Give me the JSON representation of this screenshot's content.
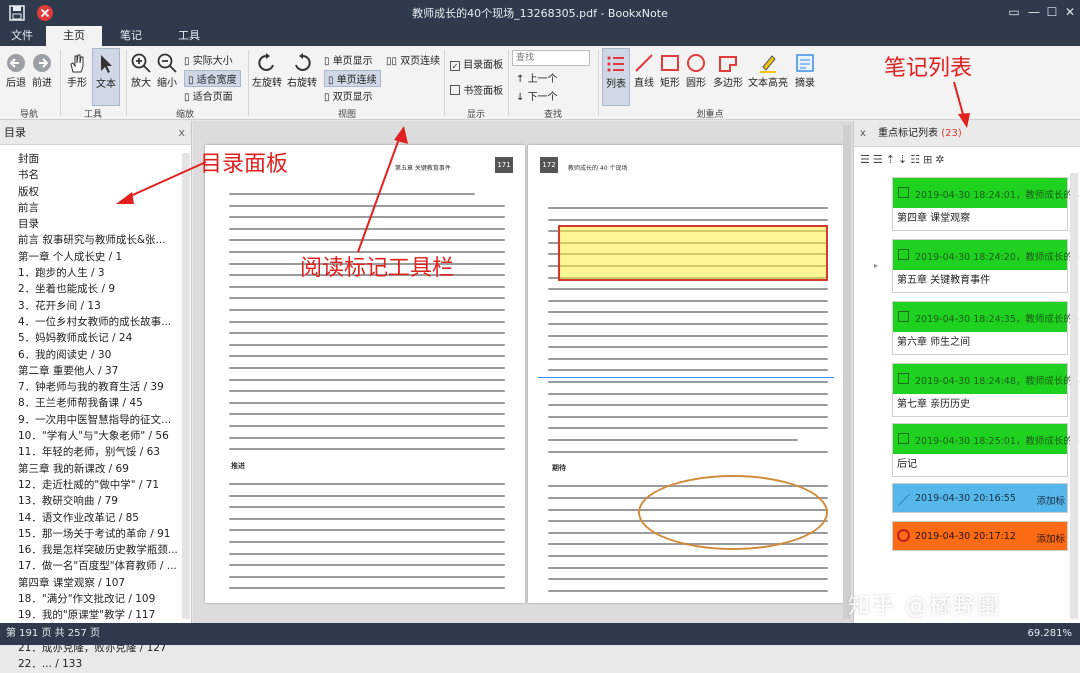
{
  "window": {
    "title": "教师成长的40个现场_13268305.pdf - BookxNote"
  },
  "tabs": [
    "文件",
    "主页",
    "笔记",
    "工具"
  ],
  "ribbon": {
    "nav": {
      "back": "后退",
      "forward": "前进",
      "group": "导航"
    },
    "tools": {
      "hand": "手形",
      "text": "文本",
      "group": "工具"
    },
    "zoom": {
      "zoom_in": "放大",
      "zoom_out": "缩小",
      "actual": "实际大小",
      "fit_width": "适合宽度",
      "fit_page": "适合页面",
      "group": "缩放"
    },
    "view": {
      "rotate_left": "左旋转",
      "rotate_right": "右旋转",
      "single": "单页显示",
      "single_cont": "单页连续",
      "double": "双页显示",
      "double_cont": "双页连续",
      "group": "视图"
    },
    "display": {
      "toc_panel": "目录面板",
      "bookmark_panel": "书签面板",
      "group": "显示"
    },
    "search": {
      "placeholder": "查找",
      "prev": "上一个",
      "next": "下一个",
      "group": "查找"
    },
    "mark": {
      "list": "列表",
      "line": "直线",
      "rect": "矩形",
      "circle": "圆形",
      "polygon": "多边形",
      "highlight": "文本高亮",
      "excerpt": "摘录",
      "group": "划重点"
    }
  },
  "left_panel": {
    "title": "目录",
    "close": "x",
    "items": [
      "封面",
      "书名",
      "版权",
      "前言",
      "目录",
      "前言  叙事研究与教师成长&张...",
      "第一章  个人成长史 / 1",
      "1．跑步的人生 / 3",
      "2．坐着也能成长 / 9",
      "3．花开乡间 / 13",
      "4．一位乡村女教师的成长故事...",
      "5．妈妈教师成长记 / 24",
      "6．我的阅读史 / 30",
      "第二章  重要他人 / 37",
      "7．钟老师与我的教育生活 / 39",
      "8．王兰老师帮我备课 / 45",
      "9．一次用中医智慧指导的征文...",
      "10．\"学有人\"与\"大象老师\" / 56",
      "11．年轻的老师，别气馁 / 63",
      "第三章  我的新课改 / 69",
      "12．走近杜威的\"做中学\" / 71",
      "13．教研交响曲 / 79",
      "14．语文作业改革记 / 85",
      "15．那一场关于考试的革命 / 91",
      "16．我是怎样突破历史教学瓶颈...",
      "17．做一名\"百度型\"体育教师 / ...",
      "第四章  课堂观察 / 107",
      "18．\"满分\"作文批改记 / 109",
      "19．我的\"原课堂\"教学 / 117",
      "20．从一堂公开课到\"三零主义\"...",
      "21．成亦克隆，败亦克隆 / 127",
      "22．...  / 133"
    ]
  },
  "pages": {
    "left": {
      "header": "第五章  关键教育事件",
      "number": "171",
      "section": "推进"
    },
    "right": {
      "header": "教师成长的 40 个现场",
      "number": "172",
      "section": "期待"
    }
  },
  "right_panel": {
    "title": "重点标记列表",
    "count": "(23)",
    "close": "x",
    "notes": [
      {
        "ts": "2019-04-30 18:24:01，教师成长的4",
        "label": "第四章 课堂观察",
        "color": "#1fd21f"
      },
      {
        "ts": "2019-04-30 18:24:20，教师成长的4",
        "label": "第五章 关键教育事件",
        "color": "#1fd21f"
      },
      {
        "ts": "2019-04-30 18:24:35，教师成长的4",
        "label": "第六章 师生之间",
        "color": "#1fd21f"
      },
      {
        "ts": "2019-04-30 18:24:48，教师成长的4",
        "label": "第七章 亲历历史",
        "color": "#1fd21f"
      },
      {
        "ts": "2019-04-30 18:25:01，教师成长的4",
        "label": "后记",
        "color": "#1fd21f"
      },
      {
        "ts": "2019-04-30 20:16:55",
        "action": "添加标",
        "color": "#56b8ea"
      },
      {
        "ts": "2019-04-30 20:17:12",
        "action": "添加标",
        "color": "#ff6a14"
      }
    ]
  },
  "status": {
    "page": "第 191 页 共 257 页",
    "zoom": "69.281%"
  },
  "annotations": {
    "toc": "目录面板",
    "toolbar": "阅读标记工具栏",
    "notes": "笔记列表"
  },
  "watermark": "知乎 @橘野園"
}
